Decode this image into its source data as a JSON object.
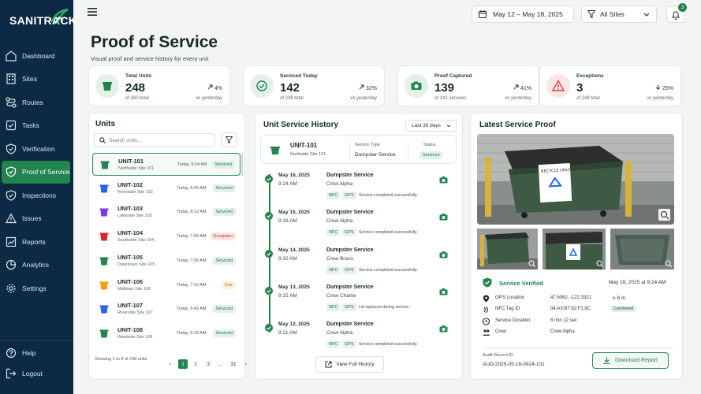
{
  "brand": "SANITRACK",
  "nav": [
    {
      "label": "Dashboard",
      "icon": "home-icon"
    },
    {
      "label": "Sites",
      "icon": "building-icon"
    },
    {
      "label": "Routes",
      "icon": "route-icon"
    },
    {
      "label": "Tasks",
      "icon": "checklist-icon"
    },
    {
      "label": "Verification",
      "icon": "shield-check-icon"
    },
    {
      "label": "Proof of Service",
      "icon": "shield-check-icon",
      "active": true
    },
    {
      "label": "Inspections",
      "icon": "shield-check-icon"
    },
    {
      "label": "Issues",
      "icon": "warning-icon"
    },
    {
      "label": "Reports",
      "icon": "chart-icon"
    },
    {
      "label": "Analytics",
      "icon": "pie-icon"
    },
    {
      "label": "Settings",
      "icon": "gear-icon"
    }
  ],
  "nav_footer": [
    {
      "label": "Help",
      "icon": "help-icon"
    },
    {
      "label": "Logout",
      "icon": "logout-icon"
    }
  ],
  "topbar": {
    "date_range": "May 12 – May 18, 2025",
    "site_filter": "All Sites",
    "notifications": "3"
  },
  "page": {
    "title": "Proof of Service",
    "subtitle": "Visual proof and service history for every unit"
  },
  "stats": [
    {
      "label": "Total Units",
      "value": "248",
      "of": "of 260 total",
      "change": "4%",
      "vs": "vs yesterday",
      "dir": "up",
      "color": "#22844e",
      "bg": "#e3f1e8"
    },
    {
      "label": "Serviced Today",
      "value": "142",
      "of": "of 248 total",
      "change": "32%",
      "vs": "vs yesterday",
      "dir": "up",
      "color": "#22844e",
      "bg": "#e3f1e8"
    },
    {
      "label": "Proof Captured",
      "value": "139",
      "of": "of 142 services",
      "change": "41%",
      "vs": "vs yesterday",
      "dir": "up",
      "color": "#22844e",
      "bg": "#e3f1e8"
    },
    {
      "label": "Exceptions",
      "value": "3",
      "of": "of 248 total",
      "change": "25%",
      "vs": "vs yesterday",
      "dir": "down",
      "color": "#d64545",
      "bg": "#fbe5e5"
    }
  ],
  "units_panel": {
    "title": "Units",
    "search_placeholder": "Search units...",
    "units": [
      {
        "name": "UNIT-101",
        "site": "Northside Site 101",
        "time": "Today, 9:24 AM",
        "status": "Serviced",
        "color": "#22844e",
        "selected": true
      },
      {
        "name": "UNIT-102",
        "site": "Riverdale Site 102",
        "time": "Today, 8:45 AM",
        "status": "Serviced",
        "color": "#2563eb"
      },
      {
        "name": "UNIT-103",
        "site": "Lakeside Site 103",
        "time": "Today, 8:12 AM",
        "status": "Serviced",
        "color": "#7c3aed"
      },
      {
        "name": "UNIT-104",
        "site": "Southside Site 104",
        "time": "Today, 7:58 AM",
        "status": "Exception",
        "color": "#dc2626"
      },
      {
        "name": "UNIT-105",
        "site": "Downtown Site 105",
        "time": "Today, 7:36 AM",
        "status": "Serviced",
        "color": "#22844e"
      },
      {
        "name": "UNIT-106",
        "site": "Midtown Site 106",
        "time": "Today, 7:10 AM",
        "status": "Due",
        "color": "#f59e0b"
      },
      {
        "name": "UNIT-107",
        "site": "Riverside Site 107",
        "time": "Today, 6:42 AM",
        "status": "Serviced",
        "color": "#2563eb"
      },
      {
        "name": "UNIT-108",
        "site": "Westside Site 108",
        "time": "Today, 6:18 AM",
        "status": "Serviced",
        "color": "#22844e"
      }
    ],
    "showing": "Showing 1 to 8 of 248 units",
    "pages": [
      "1",
      "2",
      "3",
      "...",
      "31"
    ]
  },
  "history": {
    "title": "Unit Service History",
    "range": "Last 30 days",
    "unit": {
      "name": "UNIT-101",
      "site": "Northside Site 101",
      "type_label": "Service Type",
      "type": "Dumpster Service",
      "status_label": "Status",
      "status": "Serviced"
    },
    "entries": [
      {
        "date": "May 16, 2025",
        "time": "9:24 AM",
        "service": "Dumpster Service",
        "crew": "Crew Alpha",
        "tags": [
          "NFC",
          "GPS"
        ],
        "note": "Service completed successfully."
      },
      {
        "date": "May 15, 2025",
        "time": "9:18 AM",
        "service": "Dumpster Service",
        "crew": "Crew Alpha",
        "tags": [
          "NFC",
          "GPS"
        ],
        "note": "Service completed successfully."
      },
      {
        "date": "May 14, 2025",
        "time": "9:32 AM",
        "service": "Dumpster Service",
        "crew": "Crew Bravo",
        "tags": [
          "NFC",
          "GPS"
        ],
        "note": "Service completed successfully."
      },
      {
        "date": "May 13, 2025",
        "time": "9:15 AM",
        "service": "Dumpster Service",
        "crew": "Crew Charlie",
        "tags": [
          "NFC",
          "GPS"
        ],
        "note": "Lid replaced during service."
      },
      {
        "date": "May 12, 2025",
        "time": "9:21 AM",
        "service": "Dumpster Service",
        "crew": "Crew Alpha",
        "tags": [
          "NFC",
          "GPS"
        ],
        "note": "Service completed successfully."
      }
    ],
    "view_full": "View Full History"
  },
  "proof": {
    "title": "Latest Service Proof",
    "sign_text": "RECYCLE ONLY",
    "verified": "Service Verified",
    "verified_at": "May 16, 2025 at 9:24 AM",
    "details": [
      {
        "label": "GPS Location",
        "value": "47.6062, -122.3321",
        "extra": "± 8 m",
        "icon": "pin-icon"
      },
      {
        "label": "NFC Tag ID",
        "value": "04:A3:B7:92:F1:8C",
        "extra": "Confirmed",
        "icon": "nfc-icon"
      },
      {
        "label": "Service Duration",
        "value": "8 min 12 sec",
        "extra": "",
        "icon": "clock-icon"
      },
      {
        "label": "Crew",
        "value": "Crew Alpha",
        "extra": "",
        "icon": "people-icon"
      }
    ],
    "audit_label": "Audit Record ID",
    "audit_id": "AUD-2025-05-16-0924-101",
    "download": "Download Report"
  }
}
